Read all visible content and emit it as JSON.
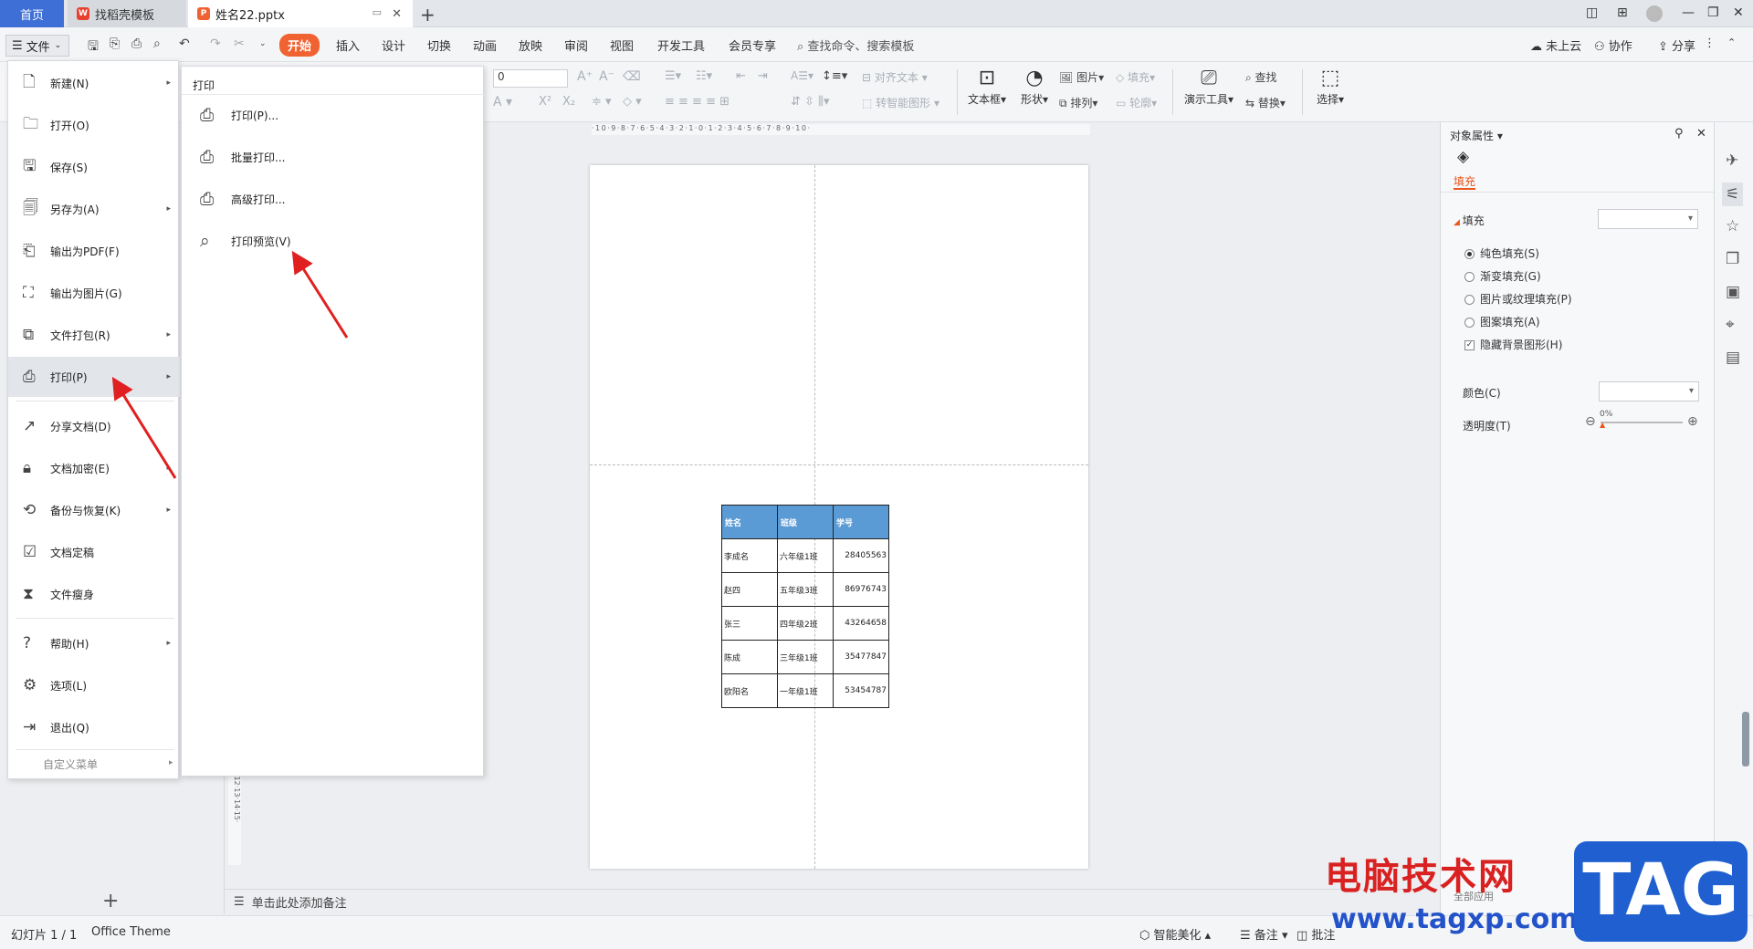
{
  "tabs": {
    "home": "首页",
    "templates": "找稻壳模板",
    "doc": "姓名22.pptx"
  },
  "menubar": {
    "file": "文件",
    "ribbon_tabs": [
      "开始",
      "插入",
      "设计",
      "切换",
      "动画",
      "放映",
      "审阅",
      "视图",
      "开发工具",
      "会员专享"
    ],
    "search_placeholder": "查找命令、搜索模板",
    "cloud": "未上云",
    "collab": "协作",
    "share": "分享"
  },
  "ribbon": {
    "font_size": "0",
    "align_text": "对齐文本",
    "smart_shape": "转智能图形",
    "textbox": "文本框",
    "shape": "形状",
    "picture": "图片",
    "arrange": "排列",
    "fill": "填充",
    "outline": "轮廓",
    "present_tools": "演示工具",
    "find": "查找",
    "replace": "替换",
    "select": "选择"
  },
  "file_menu": {
    "items": [
      {
        "label": "新建(N)",
        "icon": "new-doc-icon",
        "has_sub": true
      },
      {
        "label": "打开(O)",
        "icon": "folder-icon",
        "has_sub": false
      },
      {
        "label": "保存(S)",
        "icon": "save-icon",
        "has_sub": false
      },
      {
        "label": "另存为(A)",
        "icon": "save-as-icon",
        "has_sub": true
      },
      {
        "label": "输出为PDF(F)",
        "icon": "pdf-icon",
        "has_sub": false
      },
      {
        "label": "输出为图片(G)",
        "icon": "image-export-icon",
        "has_sub": false
      },
      {
        "label": "文件打包(R)",
        "icon": "package-icon",
        "has_sub": true
      },
      {
        "label": "打印(P)",
        "icon": "printer-icon",
        "has_sub": true
      },
      {
        "label": "分享文档(D)",
        "icon": "share-icon",
        "has_sub": false
      },
      {
        "label": "文档加密(E)",
        "icon": "lock-icon",
        "has_sub": true
      },
      {
        "label": "备份与恢复(K)",
        "icon": "backup-icon",
        "has_sub": true
      },
      {
        "label": "文档定稿",
        "icon": "finalize-icon",
        "has_sub": false
      },
      {
        "label": "文件瘦身",
        "icon": "slim-icon",
        "has_sub": false
      },
      {
        "label": "帮助(H)",
        "icon": "help-icon",
        "has_sub": true
      },
      {
        "label": "选项(L)",
        "icon": "gear-icon",
        "has_sub": false
      },
      {
        "label": "退出(Q)",
        "icon": "exit-icon",
        "has_sub": false
      }
    ],
    "custom_menu": "自定义菜单"
  },
  "print_submenu": {
    "title": "打印",
    "items": [
      "打印(P)...",
      "批量打印...",
      "高级打印...",
      "打印预览(V)"
    ]
  },
  "slide_table": {
    "headers": [
      "姓名",
      "班级",
      "学号"
    ],
    "rows": [
      [
        "李成名",
        "六年级1班",
        "28405563"
      ],
      [
        "赵四",
        "五年级3班",
        "86976743"
      ],
      [
        "张三",
        "四年级2班",
        "43264658"
      ],
      [
        "陈成",
        "三年级1班",
        "35477847"
      ],
      [
        "欧阳名",
        "一年级1班",
        "53454787"
      ]
    ]
  },
  "notes_placeholder": "单击此处添加备注",
  "status": {
    "slide_count": "幻灯片 1 / 1",
    "theme": "Office Theme",
    "beautify": "智能美化",
    "notes": "备注",
    "comments": "批注"
  },
  "right_pane": {
    "title": "对象属性",
    "tab_fill": "填充",
    "section_fill": "填充",
    "options": [
      "纯色填充(S)",
      "渐变填充(G)",
      "图片或纹理填充(P)",
      "图案填充(A)"
    ],
    "hide_bg": "隐藏背景图形(H)",
    "color_label": "颜色(C)",
    "transparency_label": "透明度(T)",
    "transparency_value": "0%",
    "apply_all": "全部应用"
  },
  "ruler": {
    "h_labels": "·10·9·8·7·6·5·4·3·2·1·0·1·2·3·4·5·6·7·8·9·10·",
    "v_labels": "·12·13·14·15·"
  },
  "watermark": {
    "text": "电脑技术网",
    "url": "www.tagxp.com",
    "badge": "TAG"
  },
  "colors": {
    "accent": "#3d6fd6",
    "start_tab": "#f06231",
    "table_header": "#5b9bd5",
    "arrow": "#e02020"
  }
}
